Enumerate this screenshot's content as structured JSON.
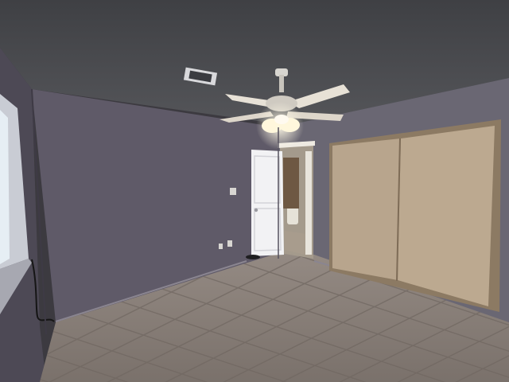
{
  "scene": {
    "kind": "photograph",
    "subject": "empty bedroom",
    "colors": {
      "ceiling": "#4a4b4f",
      "wall_back": "#5f5a68",
      "wall_left": "#4d4955",
      "wall_right": "#6a6773",
      "floor": "#8a8079",
      "grout": "#6f6660",
      "closet_door": "#b8a58d",
      "closet_trim": "#8c7a63",
      "entry_door": "#f2f2f4",
      "hallway_wall": "#a49a8c",
      "window_light": "#e6eef4",
      "fan_blade": "#e7e1d6",
      "fan_glow": "#fff7dc"
    }
  }
}
